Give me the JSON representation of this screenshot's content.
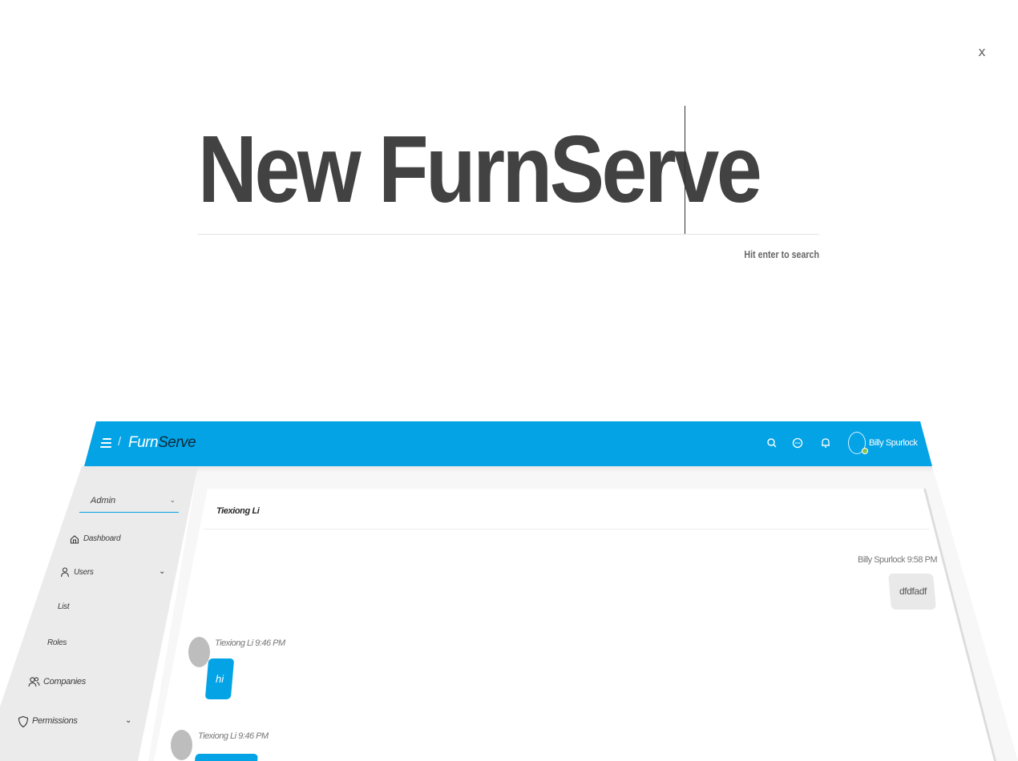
{
  "search": {
    "query": "New FurnServe",
    "hint": "Hit enter to search",
    "close_label": "x"
  },
  "app": {
    "brand_part1": "Furn",
    "brand_part2": "Serve",
    "brand_color": "#03a3e6",
    "user_name": "Billy Spurlock",
    "status_color": "#8bc34a",
    "top_icons": [
      "search-icon",
      "chat-icon",
      "bell-icon"
    ]
  },
  "sidebar": {
    "role_select": "Admin",
    "items": [
      {
        "label": "Dashboard",
        "icon": "home-icon"
      },
      {
        "label": "Users",
        "icon": "user-icon"
      },
      {
        "label": "List"
      },
      {
        "label": "Roles"
      },
      {
        "label": "Companies",
        "icon": "users-icon"
      },
      {
        "label": "Permissions",
        "icon": "shield-icon"
      }
    ]
  },
  "chat": {
    "title": "Tiexiong Li",
    "messages": [
      {
        "meta": "Billy Spurlock 9:58 PM",
        "text": "dfdfadf"
      },
      {
        "meta": "Tiexiong Li 9:46 PM",
        "text": "hi"
      },
      {
        "meta": "Tiexiong Li 9:46 PM",
        "text": ""
      }
    ]
  }
}
